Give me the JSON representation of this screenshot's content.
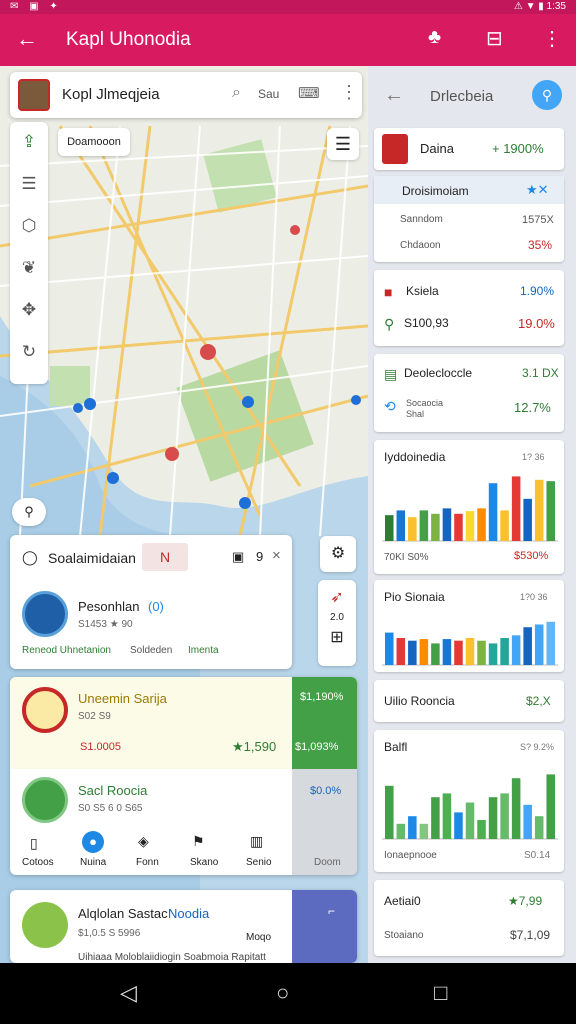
{
  "status_bar": {
    "left_icons": "✉ ▣ ✦",
    "right": "⚠ ▼ ▮ 1:35"
  },
  "app_bar": {
    "title": "Kapl Uhonodia"
  },
  "search": {
    "avatar": "map-avatar",
    "title": "Kopl Jlmeqjeia",
    "search_text": "Sau"
  },
  "map": {
    "chip": "Doamooon",
    "left_rail_icons": [
      "route-icon",
      "list-icon",
      "hexagon-icon",
      "leaf-icon",
      "directions-icon",
      "refresh-icon"
    ],
    "small_fab": "⚲"
  },
  "place_card": {
    "title": "Soalaimidaian",
    "badge": "N",
    "counter": "9",
    "item_name": "Pesonhlan",
    "item_extra": "(0)",
    "item_meta": "S1453 ★ 90",
    "footer_left": "Reneod Uhnetanion",
    "footer_mid": "Soldeden",
    "footer_right": "Imenta"
  },
  "offer_card": {
    "title": "Uneemin Sarija",
    "sub": "S02 S9",
    "price_left": "S1.0005",
    "rating": "★1,590",
    "badge": "$1,190%",
    "badge2": "$1,093%",
    "second_title": "Sacl Roocia",
    "second_sub": "S0 S5 6 0 S65",
    "second_badge": "$0.0%"
  },
  "action_bar": {
    "items": [
      "Cotoos",
      "Nuina",
      "Fonn",
      "Skano",
      "Senio"
    ],
    "side": [
      "Doom"
    ]
  },
  "bottom_card": {
    "title": "Alqlolan Sastac",
    "title_accent": "Noodia",
    "sub": "$1,0.5 S 5996",
    "right": "Moqo",
    "footer": "Uihiaaa Moloblaiidiogin Soabmoia Rapitatt"
  },
  "right_panel": {
    "title": "Drlecbeia",
    "cards": [
      {
        "title": "Daina",
        "value": "+ 1900%",
        "value_color": "#2e7d32"
      },
      {
        "title": "Droisimoiam",
        "rows": [
          {
            "label": "Sanndom",
            "value": "1575X"
          },
          {
            "label": "Chdaoon",
            "value": "35%"
          }
        ]
      },
      {
        "title": "Ksiela",
        "value": "1.90%",
        "row_label": "S100,93",
        "row_value": "19.0%"
      },
      {
        "title": "Deolecloccle",
        "value": "3.1 DX",
        "row_label": "Socaocia",
        "row_sub": "Shal",
        "row_value": "12.7%"
      },
      {
        "title": "Iyddoinedia",
        "corner": "1? 36",
        "foot_left": "70KI S0%",
        "foot_right": "$530%"
      },
      {
        "title": "Pio Sionaia",
        "corner": "1?0 36"
      },
      {
        "title": "Uilio Rooncia",
        "value": "$2,X"
      },
      {
        "title": "Balfl",
        "corner": "S? 9.2%",
        "foot_left": "Ionaepnooe",
        "foot_right": "S0.14"
      },
      {
        "title": "Aetiai0",
        "value": "★7,99",
        "foot_left": "Stoaiano",
        "foot_right": "$7,1,09"
      }
    ]
  },
  "chart_data": [
    {
      "type": "bar",
      "title": "Iyddoinedia",
      "values": [
        38,
        45,
        35,
        45,
        40,
        48,
        40,
        44,
        48,
        85,
        45,
        95,
        62,
        90,
        88
      ],
      "colors": [
        "#2e7d32",
        "#1976d2",
        "#fbc02d",
        "#43a047",
        "#7cb342",
        "#1565c0",
        "#e53935",
        "#fdd835",
        "#fb8c00",
        "#1e88e5",
        "#fbc02d",
        "#e53935",
        "#1565c0",
        "#fbc02d",
        "#43a047"
      ]
    },
    {
      "type": "bar",
      "title": "Pio Sionaia",
      "values": [
        60,
        50,
        45,
        48,
        40,
        48,
        45,
        50,
        45,
        40,
        50,
        55,
        70,
        75,
        80
      ],
      "colors": [
        "#1e88e5",
        "#e53935",
        "#1565c0",
        "#fb8c00",
        "#43a047",
        "#1976d2",
        "#e53935",
        "#fbc02d",
        "#7cb342",
        "#26a69a",
        "#26a69a",
        "#42a5f5",
        "#1565c0",
        "#42a5f5",
        "#64b5f6"
      ]
    },
    {
      "type": "bar",
      "title": "Balfl",
      "values": [
        70,
        20,
        30,
        20,
        55,
        60,
        35,
        48,
        25,
        55,
        60,
        80,
        45,
        30,
        85
      ],
      "colors": [
        "#43a047",
        "#66bb6a",
        "#1e88e5",
        "#81c784",
        "#43a047",
        "#4caf50",
        "#1e88e5",
        "#66bb6a",
        "#4caf50",
        "#43a047",
        "#66bb6a",
        "#43a047",
        "#42a5f5",
        "#66bb6a",
        "#43a047"
      ]
    }
  ],
  "nav_bar": {
    "back": "◁",
    "home": "○",
    "recent": "□"
  }
}
